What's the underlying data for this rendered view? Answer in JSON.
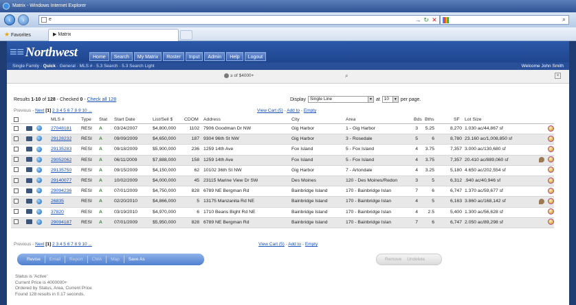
{
  "browser": {
    "title": "Matrix - Windows Internet Explorer",
    "url": "e",
    "favorites_label": "Favorites",
    "tab_label": "Matrix"
  },
  "site": {
    "logo": "Northwest",
    "nav": [
      "Home",
      "Search",
      "My Matrix",
      "Roster",
      "Input",
      "Admin",
      "Help",
      "Logout"
    ],
    "breadcrumb_pre": "Single Family · ",
    "breadcrumb_bold": "Quick",
    "breadcrumb_post": " · General · MLS # · 5.3 Search · 5.3 Search Light",
    "welcome": "Welcome John Smith"
  },
  "criteria": {
    "text": "≥ of $4000+"
  },
  "results": {
    "prefix": "Results ",
    "range": "1-10",
    "of_label": " of ",
    "total": "128",
    "checked_label": " - Checked ",
    "checked_count": "0",
    "sep": " - ",
    "check_all": "Check all 128",
    "display_label": "Display",
    "display_value": "Single Line",
    "at_label": "at",
    "per_page_value": "10",
    "per_page_label": "per page."
  },
  "pager": {
    "previous": "Previous",
    "sep": " - ",
    "next": "Next",
    "current": "[1]",
    "pages": "2 3 4 5 6 7 8 9 10 ...",
    "view_cart": "View Cart (5)",
    "add_to": "Add to",
    "empty": "Empty"
  },
  "table": {
    "headers": {
      "mls": "MLS #",
      "type": "Type",
      "stat": "Stat",
      "start_date": "Start Date",
      "list_sell": "List/Sell $",
      "cdom": "CDOM",
      "address": "Address",
      "city": "City",
      "area": "Area",
      "bds": "Bds",
      "bths": "Bths",
      "sf": "SF",
      "lot_size": "Lot Size"
    },
    "rows": [
      {
        "mls": "27048181",
        "type": "RESI",
        "stat": "A",
        "date": "03/24/2007",
        "price": "$4,800,000",
        "cdom": "1102",
        "address": "7906 Goodman Dr NW",
        "city": "Gig Harbor",
        "area": "1 - Gig Harbor",
        "bds": "3",
        "bths": "5.25",
        "sf": "8,270",
        "lot": "1.030 ac/44,867 sf",
        "pin": false
      },
      {
        "mls": "29128232",
        "type": "RESI",
        "stat": "A",
        "date": "09/09/2009",
        "price": "$4,650,000",
        "cdom": "187",
        "address": "9304 96th St NW",
        "city": "Gig Harbor",
        "area": "3 - Rosedale",
        "bds": "5",
        "bths": "6",
        "sf": "8,780",
        "lot": "23.160 ac/1,008,850 sf",
        "pin": false
      },
      {
        "mls": "29135283",
        "type": "RESI",
        "stat": "A",
        "date": "09/18/2009",
        "price": "$5,900,000",
        "cdom": "236",
        "address": "1259 14th Ave",
        "city": "Fox Island",
        "area": "5 - Fox Island",
        "bds": "4",
        "bths": "3.75",
        "sf": "7,357",
        "lot": "3.000 ac/130,680 sf",
        "pin": false
      },
      {
        "mls": "29052062",
        "type": "RESI",
        "stat": "A",
        "date": "06/11/2009",
        "price": "$7,888,000",
        "cdom": "158",
        "address": "1259 14th Ave",
        "city": "Fox Island",
        "area": "5 - Fox Island",
        "bds": "4",
        "bths": "3.75",
        "sf": "7,357",
        "lot": "20.410 ac/889,060 sf",
        "pin": true
      },
      {
        "mls": "29135750",
        "type": "RESI",
        "stat": "A",
        "date": "09/15/2009",
        "price": "$4,150,000",
        "cdom": "62",
        "address": "10102 36th St NW",
        "city": "Gig Harbor",
        "area": "7 - Artondale",
        "bds": "4",
        "bths": "3.25",
        "sf": "5,180",
        "lot": "4.650 ac/202,554 sf",
        "pin": false
      },
      {
        "mls": "29140077",
        "type": "RESI",
        "stat": "A",
        "date": "10/02/2009",
        "price": "$4,000,000",
        "cdom": "45",
        "address": "23115 Marine View Dr SW",
        "city": "Des Moines",
        "area": "120 - Des Moines/Redon",
        "bds": "3",
        "bths": "5",
        "sf": "6,312",
        "lot": ".940 ac/40,946 sf",
        "pin": false
      },
      {
        "mls": "29094236",
        "type": "RESI",
        "stat": "A",
        "date": "07/01/2009",
        "price": "$4,750,000",
        "cdom": "828",
        "address": "6789 NE Bergman Rd",
        "city": "Bainbridge Island",
        "area": "170 - Bainbridge Islan",
        "bds": "7",
        "bths": "6",
        "sf": "6,747",
        "lot": "1.370 ac/59,677 sf",
        "pin": false
      },
      {
        "mls": "26835",
        "type": "RESI",
        "stat": "A",
        "date": "02/20/2010",
        "price": "$4,866,000",
        "cdom": "5",
        "address": "13175 Manzanita Rd NE",
        "city": "Bainbridge Island",
        "area": "170 - Bainbridge Islan",
        "bds": "4",
        "bths": "5",
        "sf": "6,163",
        "lot": "3.860 ac/168,142 sf",
        "pin": true
      },
      {
        "mls": "37820",
        "type": "RESI",
        "stat": "A",
        "date": "03/19/2010",
        "price": "$4,970,000",
        "cdom": "6",
        "address": "1710 Beans Bight Rd NE",
        "city": "Bainbridge Island",
        "area": "170 - Bainbridge Islan",
        "bds": "4",
        "bths": "2.5",
        "sf": "5,400",
        "lot": "1.300 ac/56,628 sf",
        "pin": false
      },
      {
        "mls": "29094187",
        "type": "RESI",
        "stat": "A",
        "date": "07/01/2009",
        "price": "$5,950,000",
        "cdom": "828",
        "address": "6789 NE Bergman Rd",
        "city": "Bainbridge Island",
        "area": "170 - Bainbridge Islan",
        "bds": "7",
        "bths": "6",
        "sf": "6,747",
        "lot": "2.050 ac/89,298 sf",
        "pin": false
      }
    ]
  },
  "actions": {
    "revise": "Revise",
    "email": "Email",
    "report": "Report",
    "cma": "CMA",
    "map": "Map",
    "save_as": "Save As",
    "remove": "Remove",
    "undelete": "Undelete"
  },
  "status": {
    "line1": "Status is 'Active'",
    "line2": "Current Price is 4000000+",
    "line3": "Ordered by Status, Area, Current Price",
    "line4": "Found 128 results in 0.17 seconds."
  }
}
